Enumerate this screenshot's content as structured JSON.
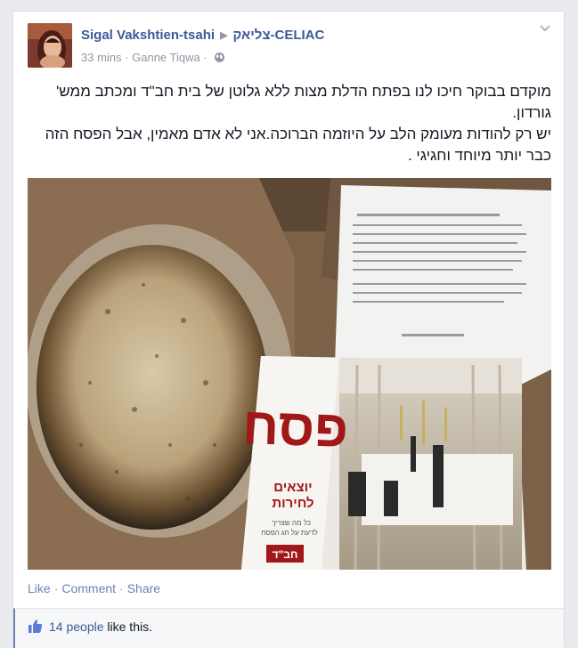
{
  "post": {
    "author": "Sigal Vakshtien-tsahi",
    "group": "צליאק-CELIAC",
    "time": "33 mins",
    "location": "Ganne Tiqwa",
    "text_lines": [
      "מוקדם בבוקר חיכו לנו בפתח הדלת מצות ללא גלוטן של בית חב\"ד ומכתב ממש' גורדון.",
      "יש רק להודות מעומק הלב על היוזמה הברוכה.אני לא אדם מאמין, אבל הפסח הזה כבר יותר מיוחד וחגיגי ."
    ]
  },
  "photo": {
    "booklet_title": "פסח",
    "booklet_subtitle_1": "יוצאים",
    "booklet_subtitle_2": "לחירות",
    "booklet_tagline_1": "כל מה שצריך",
    "booklet_tagline_2": "לדעת על חג הפסח",
    "booklet_badge": "חב\"ד"
  },
  "actions": {
    "like": "Like",
    "comment": "Comment",
    "share": "Share",
    "separator": "·"
  },
  "likes": {
    "people": "14 people",
    "suffix": " like this."
  },
  "colors": {
    "link": "#3b5998",
    "action_link": "#6d84b4",
    "muted": "#9197a3",
    "background": "#e9ebee"
  }
}
